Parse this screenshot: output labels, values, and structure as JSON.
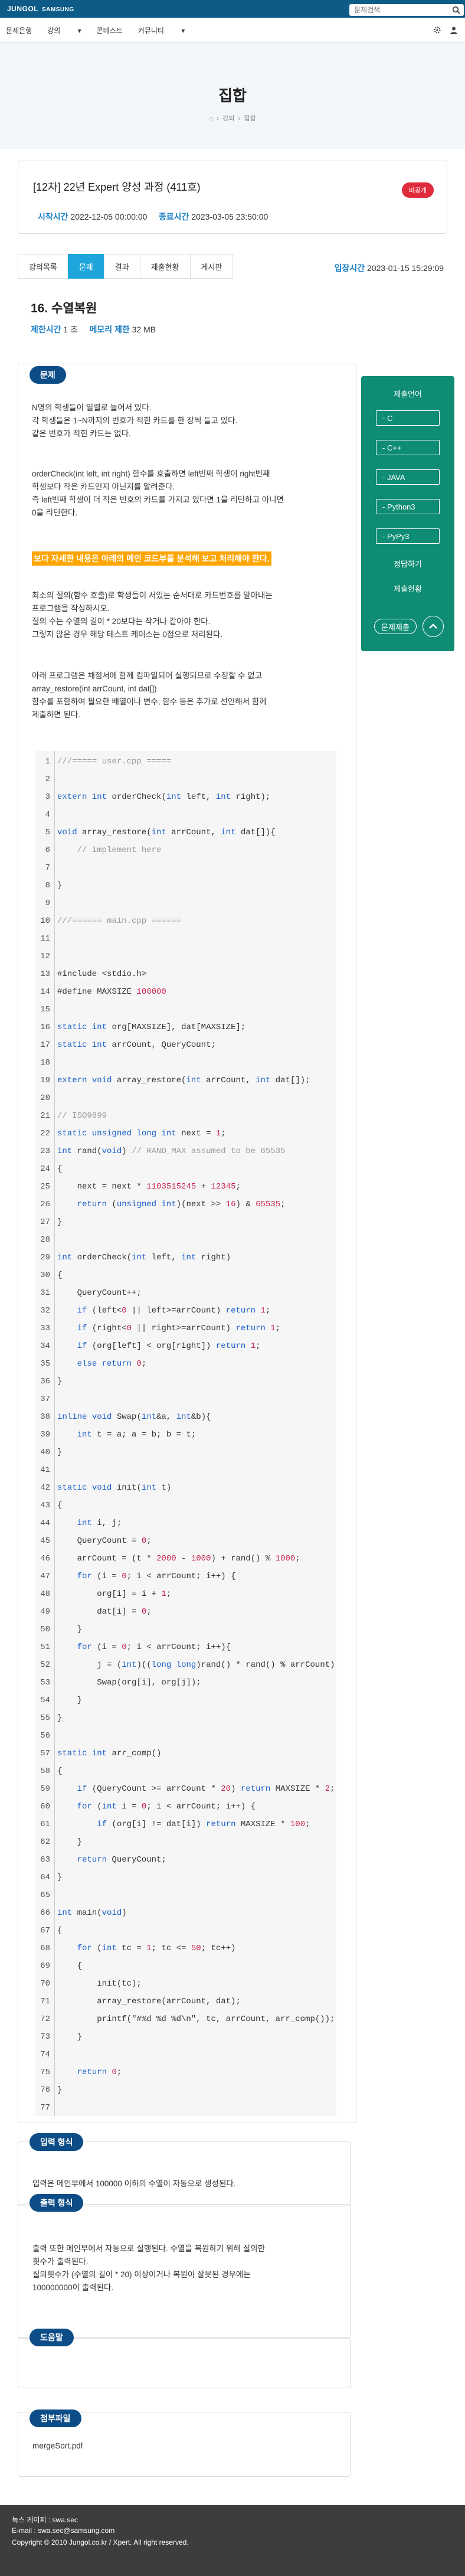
{
  "header": {
    "logo": "JUNGOL",
    "brand": "SAMSUNG",
    "search_placeholder": "문제검색",
    "menu": [
      "문제은행",
      "강의",
      "콘테스트",
      "커뮤니티"
    ]
  },
  "hero": {
    "title": "집합",
    "breadcrumb": [
      "강의",
      "집합"
    ]
  },
  "course": {
    "title": "[12차] 22년 Expert 양성 과정 (411호)",
    "badge": "비공개",
    "start_label": "시작시간",
    "start": "2022-12-05 00:00:00",
    "end_label": "종료시간",
    "end": "2023-03-05 23:50:00"
  },
  "tabs": [
    "강의목록",
    "문제",
    "결과",
    "제출현황",
    "게시판"
  ],
  "active_tab": "문제",
  "entry": {
    "label": "입장시간",
    "value": "2023-01-15 15:29:09"
  },
  "problem": {
    "title": "16. 수열복원",
    "time_label": "제한시간",
    "time": "1 초",
    "mem_label": "메모리 제한",
    "mem": "32 MB",
    "section_label": "문제",
    "desc": [
      [
        "N명의 학생들이 일렬로 늘어서 있다.",
        "각 학생들은 1~N까지의 번호가 적힌 카드를 한 장씩 들고 있다.",
        "같은 번호가 적힌 카드는 없다."
      ],
      [
        "orderCheck(int left, int right) 함수를 호출하면 left번째 학생이 right번째",
        "학생보다 작은 카드인지 아닌지를 알려준다.",
        "즉 left번째 학생이 더 작은 번호의 카드를 가지고 있다면 1을 리턴하고 아니면",
        "0을 리턴한다."
      ],
      [
        "최소의 질의(함수 호출)로 학생들이 서있는 순서대로 카드번호를 알아내는",
        "프로그램을 작성하시오.",
        "질의 수는 수열의 길이 * 20보다는 작거나 같아야 한다.",
        "그렇지 않은 경우 해당 테스트 케이스는 0점으로 처리된다."
      ],
      [
        "아래 프로그램은 채점서에 함께 컴파일되어 실행되므로 수정할 수 없고",
        "array_restore(int arrCount, int dat[])",
        "함수를 포함하여 필요한 배열이나 변수, 함수 등은 추가로 선언해서 함께",
        "제출하면 된다."
      ]
    ],
    "highlight": "보다 자세한 내용은 아래의 메인 코드부를 분석해 보고 처리해야 한다.",
    "code": [
      "///===== user.cpp =====",
      "",
      "extern int orderCheck(int left, int right);",
      "",
      "void array_restore(int arrCount, int dat[]){",
      "    // implement here",
      "",
      "}",
      "",
      "///====== main.cpp ======",
      "",
      "",
      "#include <stdio.h>",
      "#define MAXSIZE 100000",
      "",
      "static int org[MAXSIZE], dat[MAXSIZE];",
      "static int arrCount, QueryCount;",
      "",
      "extern void array_restore(int arrCount, int dat[]);",
      "",
      "// ISO9899",
      "static unsigned long int next = 1;",
      "int rand(void) // RAND_MAX assumed to be 65535",
      "{",
      "    next = next * 1103515245 + 12345;",
      "    return (unsigned int)(next >> 16) & 65535;",
      "}",
      "",
      "int orderCheck(int left, int right)",
      "{",
      "    QueryCount++;",
      "    if (left<0 || left>=arrCount) return 1;",
      "    if (right<0 || right>=arrCount) return 1;",
      "    if (org[left] < org[right]) return 1;",
      "    else return 0;",
      "}",
      "",
      "inline void Swap(int&a, int&b){",
      "    int t = a; a = b; b = t;",
      "}",
      "",
      "static void init(int t)",
      "{",
      "    int i, j;",
      "    QueryCount = 0;",
      "    arrCount = (t * 2000 - 1000) + rand() % 1000;",
      "    for (i = 0; i < arrCount; i++) {",
      "        org[i] = i + 1;",
      "        dat[i] = 0;",
      "    }",
      "    for (i = 0; i < arrCount; i++){",
      "        j = (int)((long long)rand() * rand() % arrCount);",
      "        Swap(org[i], org[j]);",
      "    }",
      "}",
      "",
      "static int arr_comp()",
      "{",
      "    if (QueryCount >= arrCount * 20) return MAXSIZE * 2;",
      "    for (int i = 0; i < arrCount; i++) {",
      "        if (org[i] != dat[i]) return MAXSIZE * 100;",
      "    }",
      "    return QueryCount;",
      "}",
      "",
      "int main(void)",
      "{",
      "    for (int tc = 1; tc <= 50; tc++)",
      "    {",
      "        init(tc);",
      "        array_restore(arrCount, dat);",
      "        printf(\"#%d %d %d\\n\", tc, arrCount, arr_comp());",
      "    }",
      "",
      "    return 0;",
      "}",
      ""
    ]
  },
  "sidebar": {
    "header": "제출언어",
    "languages": [
      "- C",
      "- C++",
      "- JAVA",
      "- Python3",
      "- PyPy3"
    ],
    "links": [
      "정답하기",
      "제출현황"
    ],
    "submit": "문제제출"
  },
  "sections": {
    "input": {
      "label": "입력 형식",
      "text": [
        "입력은 메인부에서 100000 이하의 수열이 자동으로 생성된다."
      ]
    },
    "output": {
      "label": "출력 형식",
      "text": [
        "출력 또한 메인부에서 자동으로 실행된다. 수열을 복원하기 위해 질의한",
        "횟수가 출력된다.",
        "질의횟수가 (수열의 길이 * 20) 이상이거나 복원이 잘못된 경우에는",
        "100000000이 출력된다."
      ]
    },
    "help": {
      "label": "도움말"
    },
    "attach": {
      "label": "첨부파일",
      "file": "mergeSort.pdf"
    }
  },
  "footer": {
    "lines": [
      "녹스 케이피 : swa.sec",
      "E-mail : swa.sec@samsung.com",
      "Copyright © 2010 Jungol.co.kr / Xpert. All right reserved."
    ]
  }
}
